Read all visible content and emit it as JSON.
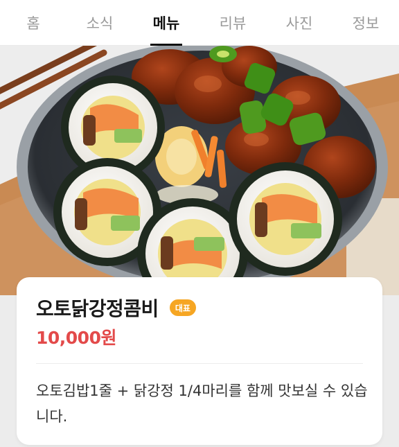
{
  "tabs": [
    {
      "label": "홈",
      "active": false
    },
    {
      "label": "소식",
      "active": false
    },
    {
      "label": "메뉴",
      "active": true
    },
    {
      "label": "리뷰",
      "active": false
    },
    {
      "label": "사진",
      "active": false
    },
    {
      "label": "정보",
      "active": false
    }
  ],
  "hero": {
    "icon": "food-photo-kimbap-dakgangjeong"
  },
  "menu_item": {
    "name": "오토닭강정콤비",
    "badge": "대표",
    "price": "10,000원",
    "description": "오토김밥1줄 + 닭강정 1/4마리를 함께 맛보실 수 있습니다."
  },
  "colors": {
    "badge": "#f6a623",
    "price": "#e34a4a",
    "active_tab": "#111111",
    "inactive_tab": "#9a9a9a"
  }
}
